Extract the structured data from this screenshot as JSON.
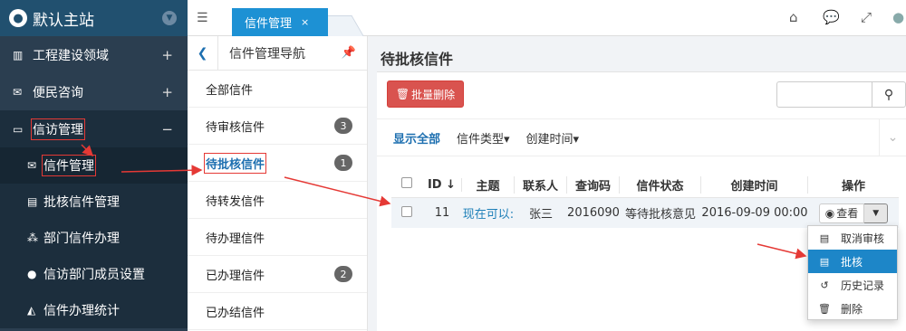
{
  "brand": {
    "title": "默认主站",
    "globe_icon": "globe-icon",
    "toggle_icon": "chevron-down-icon"
  },
  "sidebar": {
    "items": [
      {
        "label": "工程建设领域",
        "icon": "building-icon",
        "toggle": "+"
      },
      {
        "label": "便民咨询",
        "icon": "envelope-icon",
        "toggle": "+"
      },
      {
        "label": "信访管理",
        "icon": "inbox-icon",
        "toggle": "−"
      }
    ],
    "subitems": [
      {
        "label": "信件管理",
        "icon": "mail-icon"
      },
      {
        "label": "批核信件管理",
        "icon": "file-icon"
      },
      {
        "label": "部门信件办理",
        "icon": "sitemap-icon"
      },
      {
        "label": "信访部门成员设置",
        "icon": "user-icon"
      },
      {
        "label": "信件办理统计",
        "icon": "chart-icon"
      }
    ]
  },
  "topbar": {
    "tab_label": "信件管理",
    "tab_close": "×",
    "icons": [
      "home-icon",
      "comments-icon",
      "expand-icon",
      "user-icon"
    ]
  },
  "subnav": {
    "title": "信件管理导航",
    "items": [
      {
        "label": "全部信件",
        "badge": ""
      },
      {
        "label": "待审核信件",
        "badge": "3"
      },
      {
        "label": "待批核信件",
        "badge": "1"
      },
      {
        "label": "待转发信件",
        "badge": ""
      },
      {
        "label": "待办理信件",
        "badge": ""
      },
      {
        "label": "已办理信件",
        "badge": "2"
      },
      {
        "label": "已办结信件",
        "badge": ""
      }
    ]
  },
  "main": {
    "title": "待批核信件",
    "batch_delete": "批量删除",
    "search_value": "",
    "filters": [
      "显示全部",
      "信件类型▾",
      "创建时间▾"
    ]
  },
  "table": {
    "headers": [
      "ID",
      "主题",
      "联系人",
      "查询码",
      "信件状态",
      "创建时间",
      "操作"
    ],
    "rows": [
      {
        "id": "11",
        "subject": "现在可以:",
        "contact": "张三",
        "code": "2016090",
        "status": "等待批核意见",
        "created": "2016-09-09 00:00"
      }
    ],
    "view_label": "查看"
  },
  "dropdown": {
    "items": [
      {
        "label": "取消审核",
        "icon": "file-icon"
      },
      {
        "label": "批核",
        "icon": "file-check-icon"
      },
      {
        "label": "历史记录",
        "icon": "history-icon"
      },
      {
        "label": "删除",
        "icon": "trash-icon"
      }
    ]
  },
  "colors": {
    "sidebar_bg": "#2b3e50",
    "accent": "#1d91d4",
    "danger": "#d9534f",
    "annotation": "#e53935"
  }
}
